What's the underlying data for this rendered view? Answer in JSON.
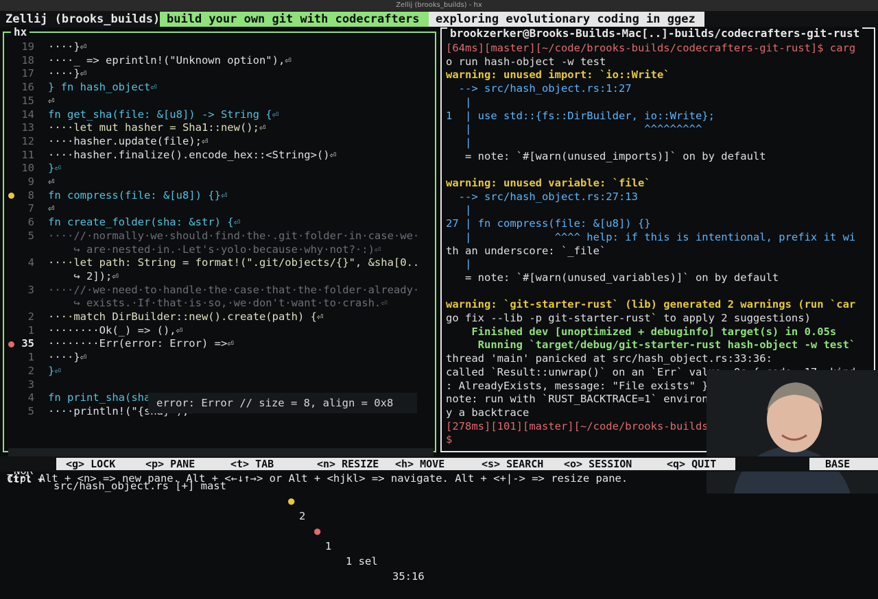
{
  "window": {
    "title": "Zellij (brooks_builds) - hx"
  },
  "tabbar": {
    "session": "Zellij (brooks_builds)",
    "tabs": [
      {
        "label": "build your own git with codecrafters",
        "active": true
      },
      {
        "label": "exploring evolutionary coding in ggez",
        "active": false
      }
    ]
  },
  "left_pane": {
    "title": "hx",
    "lines": [
      {
        "num": "19",
        "text": "····}⏎"
      },
      {
        "num": "18",
        "text": "····_ => eprintln!(\"Unknown option\"),⏎"
      },
      {
        "num": "17",
        "text": "····}⏎"
      },
      {
        "num": "16",
        "text": "} fn hash_object⏎"
      },
      {
        "num": "15",
        "text": "⏎"
      },
      {
        "num": "14",
        "text": "fn get_sha(file: &[u8]) -> String {⏎"
      },
      {
        "num": "13",
        "text": "····let mut hasher = Sha1::new();⏎"
      },
      {
        "num": "12",
        "text": "····hasher.update(file);⏎"
      },
      {
        "num": "11",
        "text": "····hasher.finalize().encode_hex::<String>()⏎"
      },
      {
        "num": "10",
        "text": "}⏎"
      },
      {
        "num": "9",
        "text": "⏎"
      },
      {
        "num": "8",
        "text": "fn compress(file: &[u8]) {}⏎"
      },
      {
        "num": "7",
        "text": "⏎"
      },
      {
        "num": "6",
        "text": "fn create_folder(sha: &str) {⏎"
      },
      {
        "num": "5",
        "text": "····//·normally·we·should·find·the·.git·folder·in·case·we·"
      },
      {
        "num": "",
        "text": "    ↪ are·nested·in.·Let's·yolo·because·why·not?·:)⏎"
      },
      {
        "num": "4",
        "text": "····let path: String = format!(\".git/objects/{}\", &sha[0.."
      },
      {
        "num": "",
        "text": "    ↪ 2]);⏎"
      },
      {
        "num": "3",
        "text": "····//·we·need·to·handle·the·case·that·the·folder·already·"
      },
      {
        "num": "",
        "text": "    ↪ exists.·If·that·is·so,·we·don't·want·to·crash.⏎"
      },
      {
        "num": "2",
        "text": "····match DirBuilder::new().create(path) {⏎"
      },
      {
        "num": "1",
        "text": "········Ok(_) => (),⏎"
      },
      {
        "num": "35",
        "text": "········Err(error: Error) =>⏎"
      },
      {
        "num": "1",
        "text": "····}⏎"
      },
      {
        "num": "2",
        "text": "}⏎"
      },
      {
        "num": "3",
        "text": ""
      },
      {
        "num": "4",
        "text": "fn print_sha(sha: &str) {⏎"
      },
      {
        "num": "5",
        "text": "····println!(\"{sha}\");⏎"
      }
    ],
    "hover": "error: Error // size = 8, align = 0x8",
    "status": {
      "mode": "NOR",
      "file": "src/hash_object.rs [+] mast",
      "warnings": "2",
      "errors": "1",
      "selection": "1 sel",
      "position": "35:16"
    }
  },
  "right_pane": {
    "title": "brookzerker@Brooks-Builds-Mac[..]-builds/codecrafters-git-rust",
    "lines": [
      "[64ms][master][~/code/brooks-builds/codecrafters-git-rust]$ carg",
      "o run hash-object -w test",
      "warning: unused import: `io::Write`",
      "  --> src/hash_object.rs:1:27",
      "   |",
      "1  | use std::{fs::DirBuilder, io::Write};",
      "   |                           ^^^^^^^^^",
      "   |",
      "   = note: `#[warn(unused_imports)]` on by default",
      "",
      "warning: unused variable: `file`",
      "  --> src/hash_object.rs:27:13",
      "   |",
      "27 | fn compress(file: &[u8]) {}",
      "   |             ^^^^ help: if this is intentional, prefix it wi",
      "th an underscore: `_file`",
      "   |",
      "   = note: `#[warn(unused_variables)]` on by default",
      "",
      "warning: `git-starter-rust` (lib) generated 2 warnings (run `car",
      "go fix --lib -p git-starter-rust` to apply 2 suggestions)",
      "    Finished dev [unoptimized + debuginfo] target(s) in 0.05s",
      "     Running `target/debug/git-starter-rust hash-object -w test`",
      "thread 'main' panicked at src/hash_object.rs:33:36:",
      "called `Result::unwrap()` on an `Err` value: Os { code: 17, kind",
      ": AlreadyExists, message: \"File exists\" }",
      "note: run with `RUST_BACKTRACE=1` environment v     to displa",
      "y a backtrace",
      "[278ms][101][master][~/code/brooks-builds/codec       git-rust]",
      "$ "
    ]
  },
  "bottombar": {
    "prefix": "Ctrl +",
    "keys": [
      {
        "key": "<g>",
        "label": "LOCK"
      },
      {
        "key": "<p>",
        "label": "PANE"
      },
      {
        "key": "<t>",
        "label": "TAB"
      },
      {
        "key": "<n>",
        "label": "RESIZE"
      },
      {
        "key": "<h>",
        "label": "MOVE"
      },
      {
        "key": "<s>",
        "label": "SEARCH"
      },
      {
        "key": "<o>",
        "label": "SESSION"
      },
      {
        "key": "<q>",
        "label": "QUIT"
      },
      {
        "key": "",
        "label": "BASE"
      }
    ]
  },
  "tip": "Tip: Alt + <n> => new pane. Alt + <←↓↑→> or Alt + <hjkl> => navigate. Alt + <+|-> => resize pane.",
  "colors": {
    "active_green": "#8fe27a",
    "warning_yellow": "#e8c93b",
    "error_red": "#e26a6a"
  }
}
